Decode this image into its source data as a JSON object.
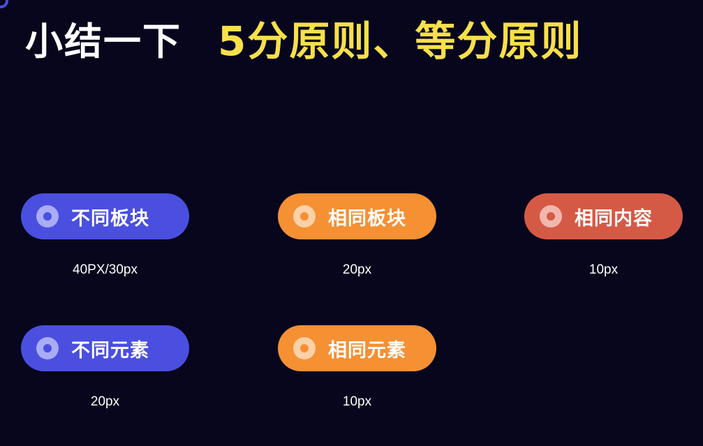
{
  "title": {
    "main": "小结一下",
    "highlight": "5分原则、等分原则"
  },
  "colors": {
    "background": "#07061d",
    "title_highlight": "#f7e04a",
    "blue_pill": "#4a4fe0",
    "orange_pill": "#f59033",
    "red_pill": "#d55a45"
  },
  "items": [
    {
      "label": "不同板块",
      "spacing": "40PX/30px",
      "color": "blue"
    },
    {
      "label": "相同板块",
      "spacing": "20px",
      "color": "orange"
    },
    {
      "label": "相同内容",
      "spacing": "10px",
      "color": "red"
    },
    {
      "label": "不同元素",
      "spacing": "20px",
      "color": "blue"
    },
    {
      "label": "相同元素",
      "spacing": "10px",
      "color": "orange"
    }
  ]
}
